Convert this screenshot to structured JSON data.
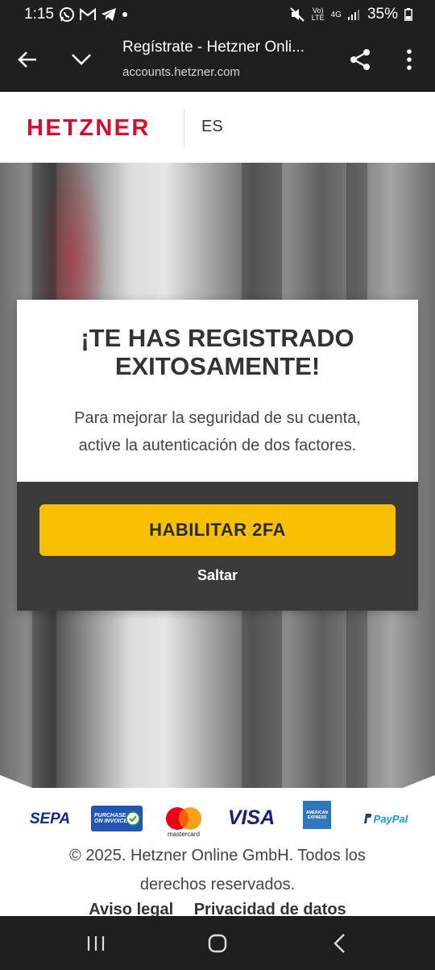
{
  "status_bar": {
    "time": "1:15",
    "network": "4G",
    "volte": "VoLTE",
    "battery": "35%"
  },
  "toolbar": {
    "title": "Regístrate - Hetzner Onli...",
    "url": "accounts.hetzner.com"
  },
  "header": {
    "logo": "HETZNER",
    "language": "ES"
  },
  "card": {
    "title_line1": "¡TE HAS REGISTRADO",
    "title_line2": "EXITOSAMENTE!",
    "text_line1": "Para mejorar la seguridad de su cuenta,",
    "text_line2": "active la autenticación de dos factores.",
    "enable_button": "HABILITAR 2FA",
    "skip_link": "Saltar"
  },
  "footer": {
    "payment_methods": {
      "sepa": "SEPA",
      "invoice_line1": "PURCHASE",
      "invoice_line2": "ON INVOICE",
      "mastercard": "mastercard",
      "visa": "VISA",
      "amex_line1": "AMERICAN",
      "amex_line2": "EXPRESS",
      "paypal": "PayPal"
    },
    "copyright_line1": "© 2025. Hetzner Online GmbH. Todos los",
    "copyright_line2": "derechos reservados.",
    "link_legal": "Aviso legal",
    "link_privacy": "Privacidad de datos"
  },
  "colors": {
    "brand_red": "#d50c2d",
    "button_yellow": "#f8c000",
    "card_dark": "#3b3b3b"
  }
}
